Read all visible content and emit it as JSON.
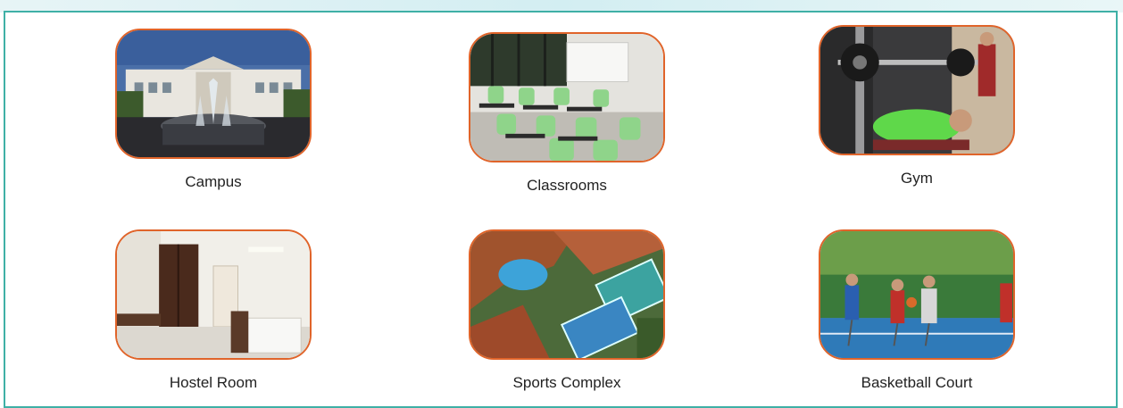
{
  "facilities": [
    {
      "label": "Campus",
      "image": "campus-building-fountain"
    },
    {
      "label": "Classrooms",
      "image": "classroom-green-chairs"
    },
    {
      "label": "Gym",
      "image": "gym-bench-press"
    },
    {
      "label": "Hostel Room",
      "image": "hostel-room-beds-wardrobe"
    },
    {
      "label": "Sports Complex",
      "image": "aerial-sports-complex-pool-courts"
    },
    {
      "label": "Basketball Court",
      "image": "basketball-court-players"
    }
  ],
  "colors": {
    "frame_border": "#3fb0a6",
    "thumb_border": "#e0642a",
    "caption": "#222222"
  }
}
